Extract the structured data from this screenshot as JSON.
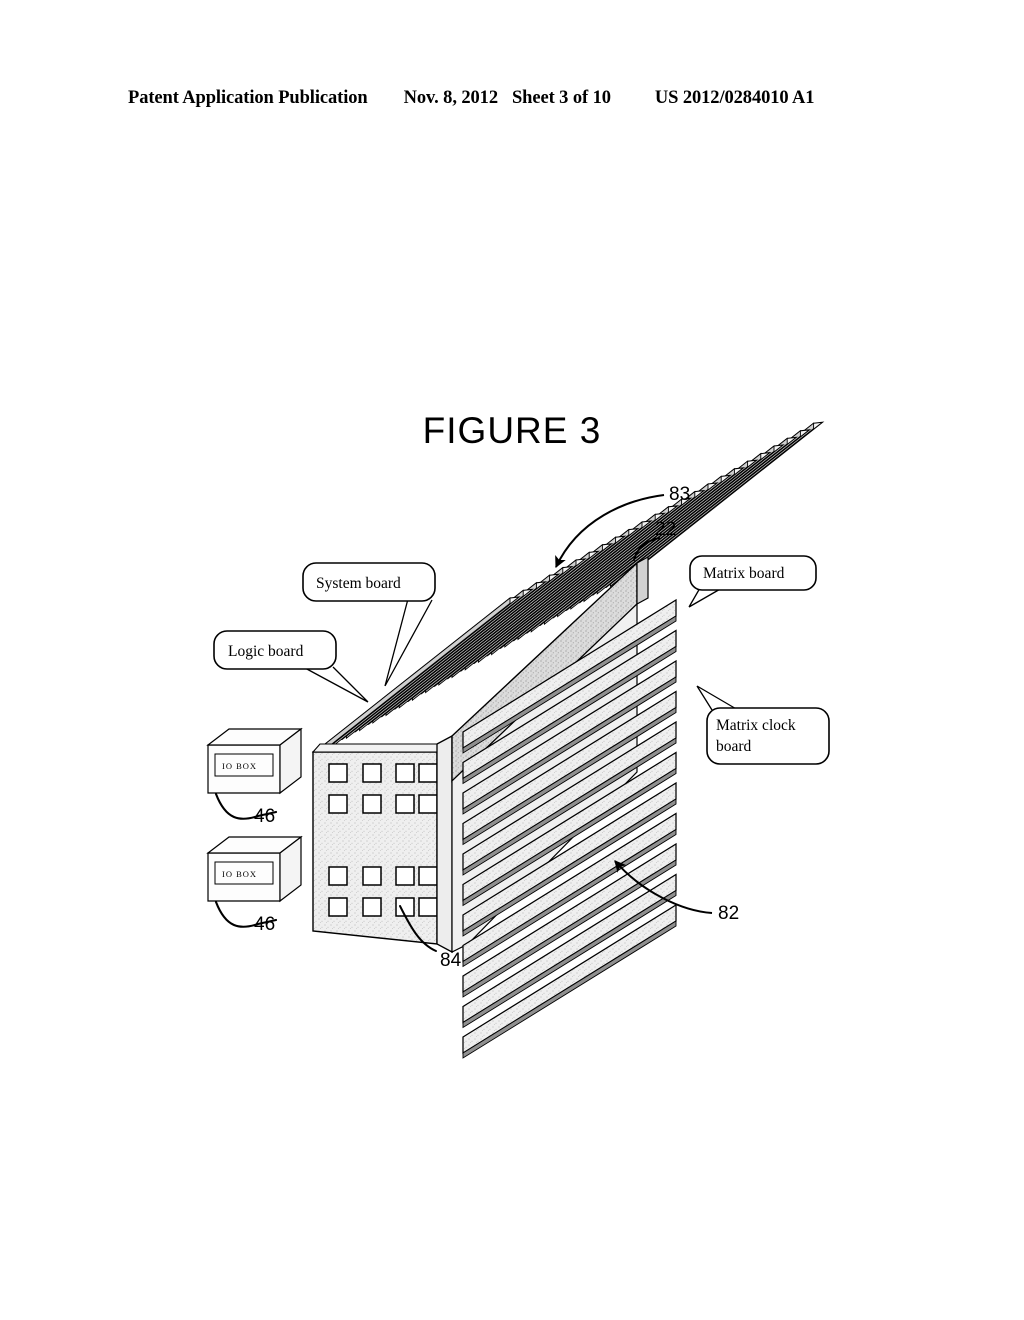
{
  "header": {
    "publication": "Patent Application Publication",
    "date": "Nov. 8, 2012",
    "sheet": "Sheet 3 of 10",
    "patent_number": "US 2012/0284010 A1"
  },
  "figure": {
    "title": "FIGURE 3",
    "callouts": [
      {
        "id": "system-board",
        "label": "System board"
      },
      {
        "id": "logic-board",
        "label": "Logic board"
      },
      {
        "id": "matrix-board",
        "label": "Matrix board"
      },
      {
        "id": "matrix-clock-board",
        "label_line1": "Matrix clock",
        "label_line2": "board"
      }
    ],
    "io_boxes": [
      {
        "label": "IO BOX",
        "ref": "46"
      },
      {
        "label": "IO BOX",
        "ref": "46"
      }
    ],
    "reference_numerals": [
      {
        "id": "ref-83",
        "value": "83"
      },
      {
        "id": "ref-22",
        "value": "22"
      },
      {
        "id": "ref-82",
        "value": "82"
      },
      {
        "id": "ref-84",
        "value": "84"
      },
      {
        "id": "ref-46-top",
        "value": "46"
      },
      {
        "id": "ref-46-bottom",
        "value": "46"
      }
    ],
    "colors": {
      "line": "#000000",
      "panel_fill": "#e8e8e8",
      "backplane_fill": "#d4d4d4",
      "board_face": "#efefef",
      "board_edge": "#f7f7f7",
      "background": "#ffffff"
    },
    "counts": {
      "vertical_boards": 24,
      "matrix_boards": 11,
      "front_panel_socket_rows": 4,
      "front_panel_socket_cols": 4
    }
  }
}
